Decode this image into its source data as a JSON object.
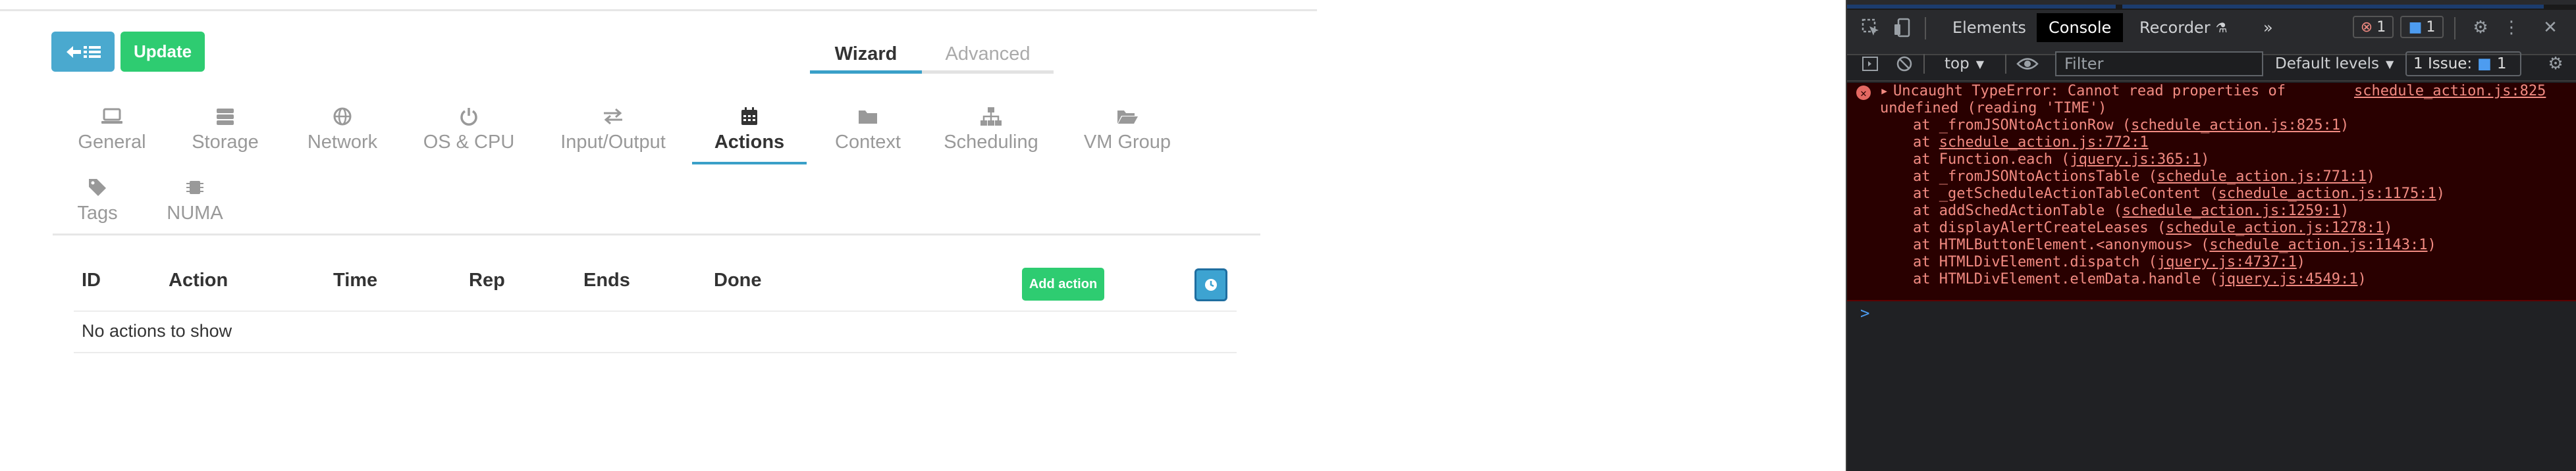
{
  "app": {
    "update_label": "Update",
    "mode_tabs": [
      {
        "label": "Wizard"
      },
      {
        "label": "Advanced"
      }
    ],
    "section_tabs": [
      {
        "label": "General",
        "icon": "laptop-icon"
      },
      {
        "label": "Storage",
        "icon": "database-icon"
      },
      {
        "label": "Network",
        "icon": "globe-icon"
      },
      {
        "label": "OS & CPU",
        "icon": "power-icon"
      },
      {
        "label": "Input/Output",
        "icon": "exchange-icon"
      },
      {
        "label": "Actions",
        "icon": "calendar-icon"
      },
      {
        "label": "Context",
        "icon": "folder-icon"
      },
      {
        "label": "Scheduling",
        "icon": "sitemap-icon"
      },
      {
        "label": "VM Group",
        "icon": "folder-open-icon"
      },
      {
        "label": "Tags",
        "icon": "tag-icon"
      },
      {
        "label": "NUMA",
        "icon": "chip-icon"
      }
    ],
    "active_tab": "Actions",
    "table": {
      "headers": [
        "ID",
        "Action",
        "Time",
        "Rep",
        "Ends",
        "Done"
      ],
      "add_label": "Add action",
      "empty_message": "No actions to show"
    },
    "colors": {
      "accent": "#3aa0c8",
      "success": "#2ecc71"
    }
  },
  "devtools": {
    "tabs": [
      "Elements",
      "Console",
      "Recorder",
      "»"
    ],
    "active_tab": "Console",
    "error_count": "1",
    "message_count": "1",
    "context": "top",
    "filter_placeholder": "Filter",
    "levels": "Default levels",
    "issues_label": "1 Issue:",
    "issues_count": "1",
    "error": {
      "message_1": "Uncaught TypeError: Cannot read properties of",
      "message_2": "undefined (reading 'TIME')",
      "source": "schedule_action.js:825",
      "stack": [
        {
          "pre": "at _fromJSONtoActionRow (",
          "link": "schedule_action.js:825:1",
          "post": ")"
        },
        {
          "pre": "at ",
          "link": "schedule_action.js:772:1",
          "post": ""
        },
        {
          "pre": "at Function.each (",
          "link": "jquery.js:365:1",
          "post": ")"
        },
        {
          "pre": "at _fromJSONtoActionsTable (",
          "link": "schedule_action.js:771:1",
          "post": ")"
        },
        {
          "pre": "at _getScheduleActionTableContent (",
          "link": "schedule_action.js:1175:1",
          "post": ")"
        },
        {
          "pre": "at addSchedActionTable (",
          "link": "schedule_action.js:1259:1",
          "post": ")"
        },
        {
          "pre": "at displayAlertCreateLeases (",
          "link": "schedule_action.js:1278:1",
          "post": ")"
        },
        {
          "pre": "at HTMLButtonElement.<anonymous> (",
          "link": "schedule_action.js:1143:1",
          "post": ")"
        },
        {
          "pre": "at HTMLDivElement.dispatch (",
          "link": "jquery.js:4737:1",
          "post": ")"
        },
        {
          "pre": "at HTMLDivElement.elemData.handle (",
          "link": "jquery.js:4549:1",
          "post": ")"
        }
      ]
    },
    "prompt": ">"
  }
}
